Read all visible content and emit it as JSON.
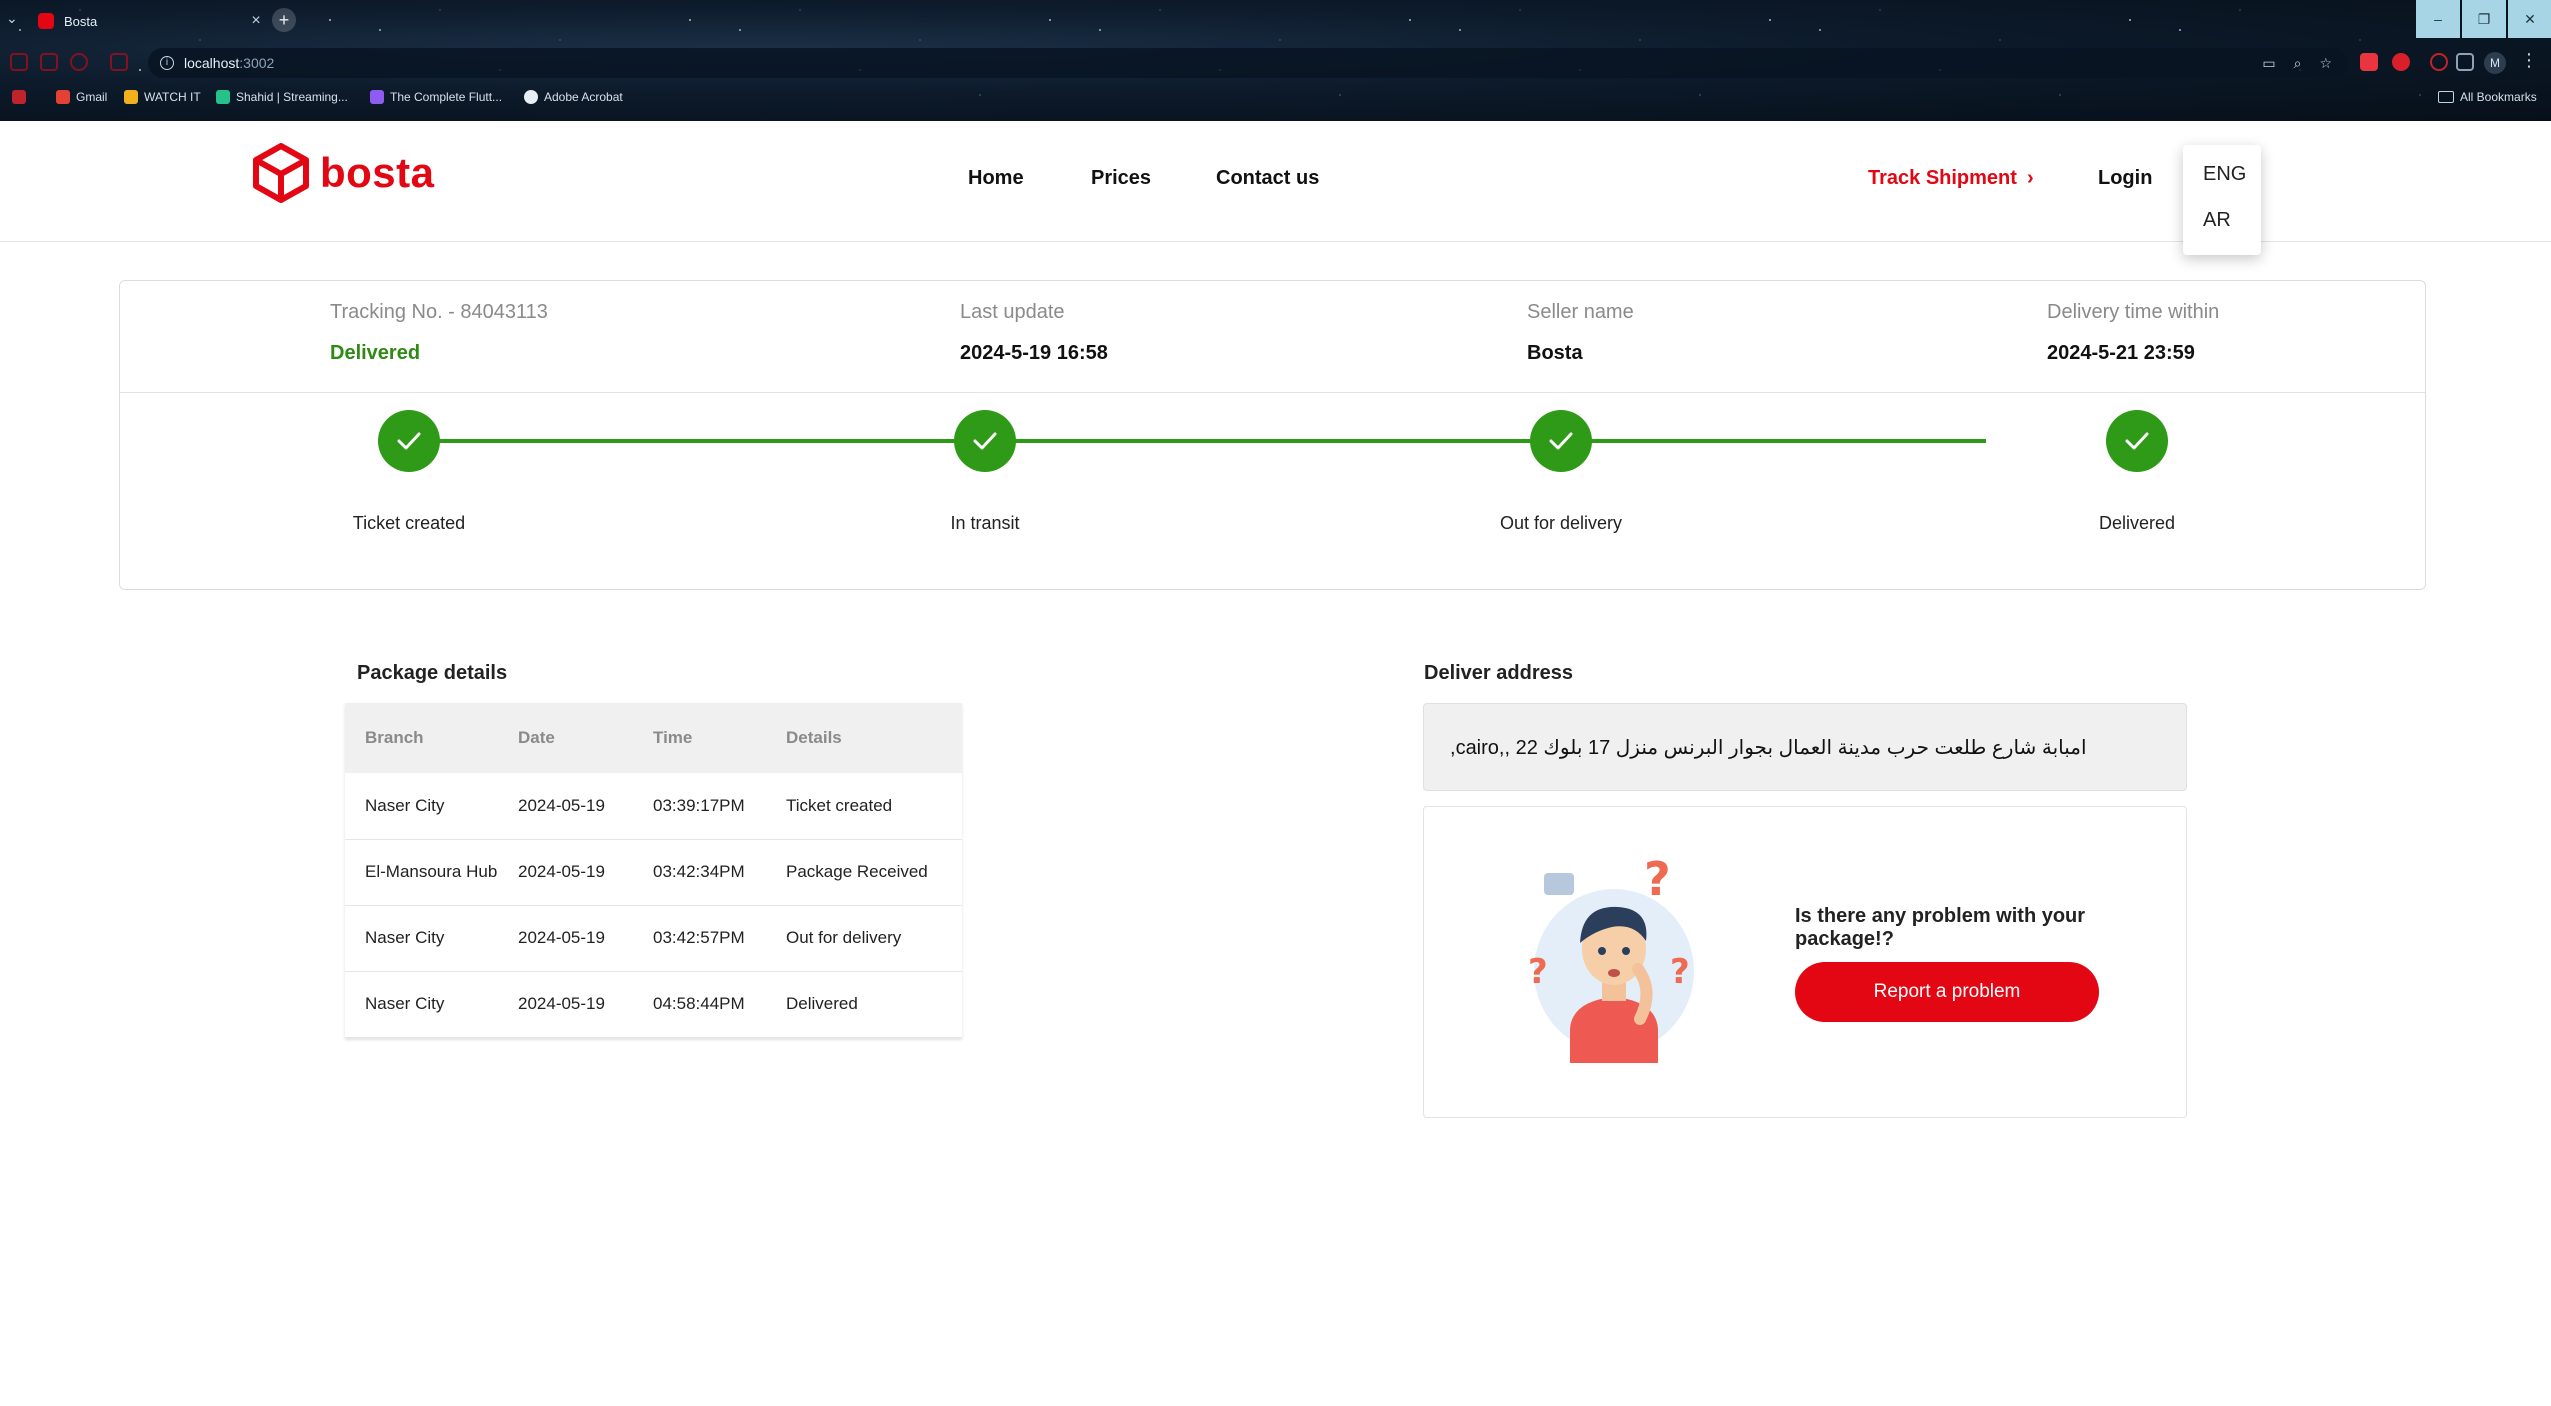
{
  "browser": {
    "tab_title": "Bosta",
    "url_host": "localhost",
    "url_port": ":3002",
    "bookmarks": [
      "Gmail",
      "WATCH IT",
      "Shahid | Streaming...",
      "The Complete Flutt...",
      "Adobe Acrobat"
    ],
    "all_bookmarks": "All Bookmarks",
    "profile_initial": "M"
  },
  "header": {
    "logo_text": "bosta",
    "nav": [
      "Home",
      "Prices",
      "Contact us"
    ],
    "track_shipment": "Track Shipment",
    "login": "Login",
    "languages": [
      "ENG",
      "AR"
    ]
  },
  "tracking": {
    "tracking_label": "Tracking No. - 84043113",
    "status": "Delivered",
    "last_update_label": "Last update",
    "last_update_value": "2024-5-19 16:58",
    "seller_label": "Seller name",
    "seller_value": "Bosta",
    "delivery_label": "Delivery time within",
    "delivery_value": "2024-5-21 23:59",
    "steps": [
      "Ticket created",
      "In transit",
      "Out for delivery",
      "Delivered"
    ]
  },
  "package": {
    "title": "Package details",
    "headers": [
      "Branch",
      "Date",
      "Time",
      "Details"
    ],
    "rows": [
      [
        "Naser City",
        "2024-05-19",
        "03:39:17PM",
        "Ticket created"
      ],
      [
        "El-Mansoura Hub",
        "2024-05-19",
        "03:42:34PM",
        "Package Received"
      ],
      [
        "Naser City",
        "2024-05-19",
        "03:42:57PM",
        "Out for delivery"
      ],
      [
        "Naser City",
        "2024-05-19",
        "04:58:44PM",
        "Delivered"
      ]
    ]
  },
  "address": {
    "title": "Deliver address",
    "text": "امبابة شارع طلعت حرب مدينة العمال بجوار البرنس منزل 17 بلوك 22 ,,cairo,"
  },
  "problem": {
    "question": "Is there any problem with your package!?",
    "button": "Report a problem"
  },
  "colors": {
    "brand": "#e30613",
    "success": "#2f9a18"
  }
}
